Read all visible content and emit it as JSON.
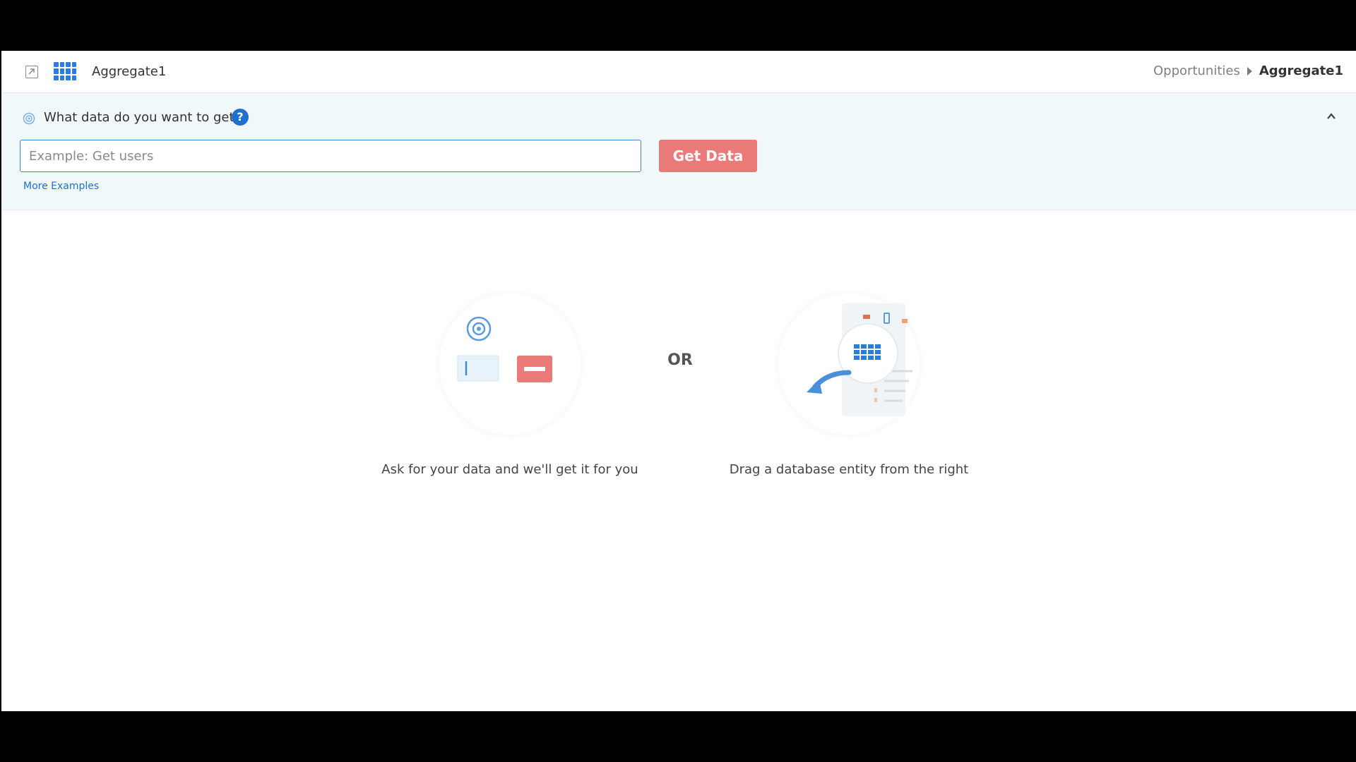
{
  "header": {
    "title": "Aggregate1",
    "breadcrumb": {
      "parent": "Opportunities",
      "current": "Aggregate1"
    },
    "icons": {
      "expand": "open-external-icon",
      "aggregate": "grid-table-icon"
    }
  },
  "query": {
    "label": "What data do you want to get?",
    "help": "?",
    "input_value": "",
    "placeholder": "Example: Get users",
    "button_label": "Get Data",
    "more_examples": "More Examples",
    "icons": {
      "target": "target-icon",
      "collapse": "chevron-up-icon"
    }
  },
  "empty_state": {
    "left_caption": "Ask for your data and we'll get it for you",
    "separator": "OR",
    "right_caption": "Drag a database entity from the right"
  },
  "colors": {
    "accent_blue": "#1f6fd1",
    "button_red": "#e97a78",
    "panel_bg": "#f1f8f9",
    "grid_blue": "#2d7be0"
  }
}
